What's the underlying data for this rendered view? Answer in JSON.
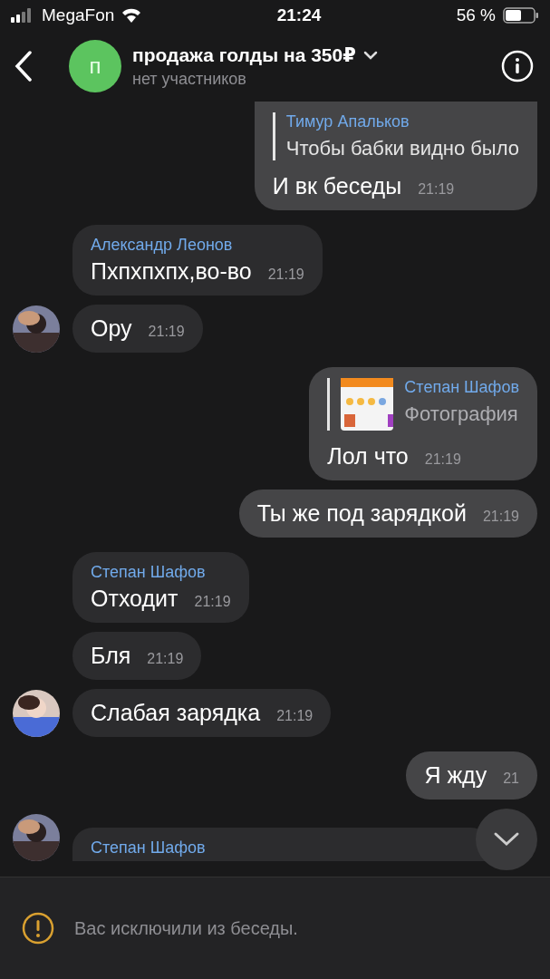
{
  "status_bar": {
    "carrier": "MegaFon",
    "time": "21:24",
    "battery": "56 %"
  },
  "header": {
    "avatar_letter": "п",
    "title": "продажа голды на 350₽",
    "subtitle": "нет участников"
  },
  "messages": [
    {
      "kind": "outgoing",
      "reply": {
        "kind": "text",
        "sender": "Тимур Апальков",
        "text": "Чтобы бабки видно было"
      },
      "text": "И вк беседы",
      "time": "21:19"
    },
    {
      "kind": "incoming",
      "avatar": false,
      "sender": "Александр Леонов",
      "text": "Пхпхпхпх,во-во",
      "time": "21:19"
    },
    {
      "kind": "incoming",
      "avatar": true,
      "text": "Ору",
      "time": "21:19"
    },
    {
      "kind": "outgoing",
      "reply": {
        "sender": "Степан Шафов",
        "text": "Фотография"
      },
      "text": "Лол что",
      "time": "21:19"
    },
    {
      "kind": "outgoing",
      "text": "Ты же под зарядкой",
      "time": "21:19"
    },
    {
      "kind": "incoming",
      "avatar": false,
      "sender": "Степан Шафов",
      "text": "Отходит",
      "time": "21:19"
    },
    {
      "kind": "incoming",
      "avatar": false,
      "text": "Бля",
      "time": "21:19"
    },
    {
      "kind": "incoming",
      "avatar": true,
      "text": "Слабая зарядка",
      "time": "21:19"
    },
    {
      "kind": "outgoing",
      "text": "Я жду",
      "time": "21"
    },
    {
      "kind": "incoming",
      "avatar": true,
      "sender": "Степан Шафов"
    }
  ],
  "footer": {
    "notice": "Вас исключили из беседы."
  }
}
